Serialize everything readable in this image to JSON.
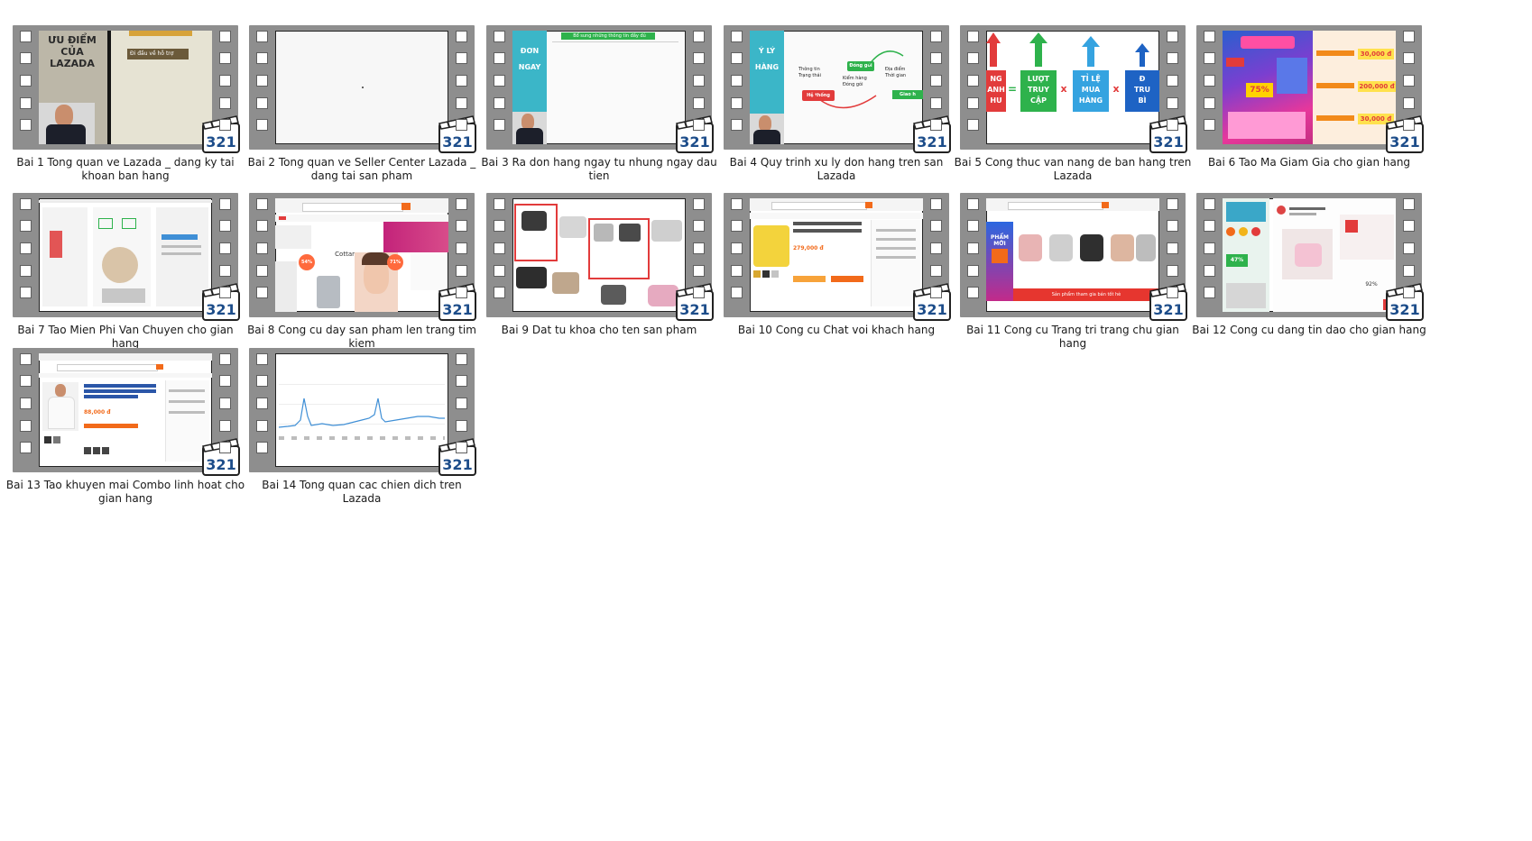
{
  "files": [
    {
      "label": "Bai 1 Tong quan ve Lazada _ dang ky tai khoan ban hang",
      "thumb": {
        "slide_title": "ƯU ĐIỂM CỦA LAZADA",
        "box": "Đi đầu về hỗ trợ"
      }
    },
    {
      "label": "Bai 2 Tong quan ve Seller Center Lazada _ dang tai san pham"
    },
    {
      "label": "Bai 3 Ra don hang ngay tu nhung ngay dau tien",
      "thumb": {
        "side_text": "ĐƠN NGAY",
        "bar_text": "Bổ sung những thông tin đầy đủ"
      }
    },
    {
      "label": "Bai 4 Quy trinh xu ly don hang tren san Lazada",
      "thumb": {
        "side_text": "Ý LÝ HÀNG",
        "n1": "Thông tin\nTrạng thái",
        "n2": "Đóng gói",
        "n3": "Kiểm hàng\nĐóng gói",
        "n4": "Hệ thống",
        "n5": "Địa điểm\nThời gian",
        "n6": "Giao h"
      }
    },
    {
      "label": "Bai 5 Cong thuc van nang de ban hang tren Lazada",
      "thumb": {
        "t1": "NG\nANH\nHU",
        "eq": "=",
        "t2": "LƯỢT\nTRUY\nCẬP",
        "x": "x",
        "t3": "TỈ LỆ\nMUA\nHÀNG",
        "t4": "Đ\nTRU\nBÌ"
      }
    },
    {
      "label": "Bai 6 Tao Ma Giam Gia cho gian hang",
      "thumb": {
        "p1": "30,000 đ",
        "p2": "200,000 đ",
        "p3": "30,000 đ",
        "pct": "75%"
      }
    },
    {
      "label": "Bai 7 Tao Mien Phi Van Chuyen cho gian hang"
    },
    {
      "label": "Bai 8 Cong cu day san pham len trang tim kiem",
      "thumb": {
        "brand": "Cottana",
        "d1": "54%",
        "d2": "71%"
      }
    },
    {
      "label": "Bai 9 Dat tu khoa cho ten san pham"
    },
    {
      "label": "Bai 10 Cong cu Chat voi khach hang",
      "thumb": {
        "price": "279,000 đ"
      }
    },
    {
      "label": "Bai 11 Cong cu Trang tri trang chu gian hang",
      "thumb": {
        "promo": "PHẨM MỚI",
        "banner": "Sản phẩm tham gia bán tốt hè"
      }
    },
    {
      "label": "Bai 12 Cong cu dang tin dao cho gian hang",
      "thumb": {
        "pct": "47%",
        "pct2": "92%"
      }
    },
    {
      "label": "Bai 13 Tao khuyen mai Combo linh hoat cho gian hang",
      "thumb": {
        "price": "88,000 đ"
      }
    },
    {
      "label": "Bai 14 Tong quan cac chien dich tren Lazada"
    }
  ],
  "badge_text": "321",
  "colors": {
    "film": "#8e8e8e",
    "teal": "#3bb6c8",
    "green": "#2eb24c",
    "blue": "#35a3e0",
    "red": "#e23b3b",
    "orange": "#f28a1a",
    "chart_line": "#3f8fd6"
  }
}
